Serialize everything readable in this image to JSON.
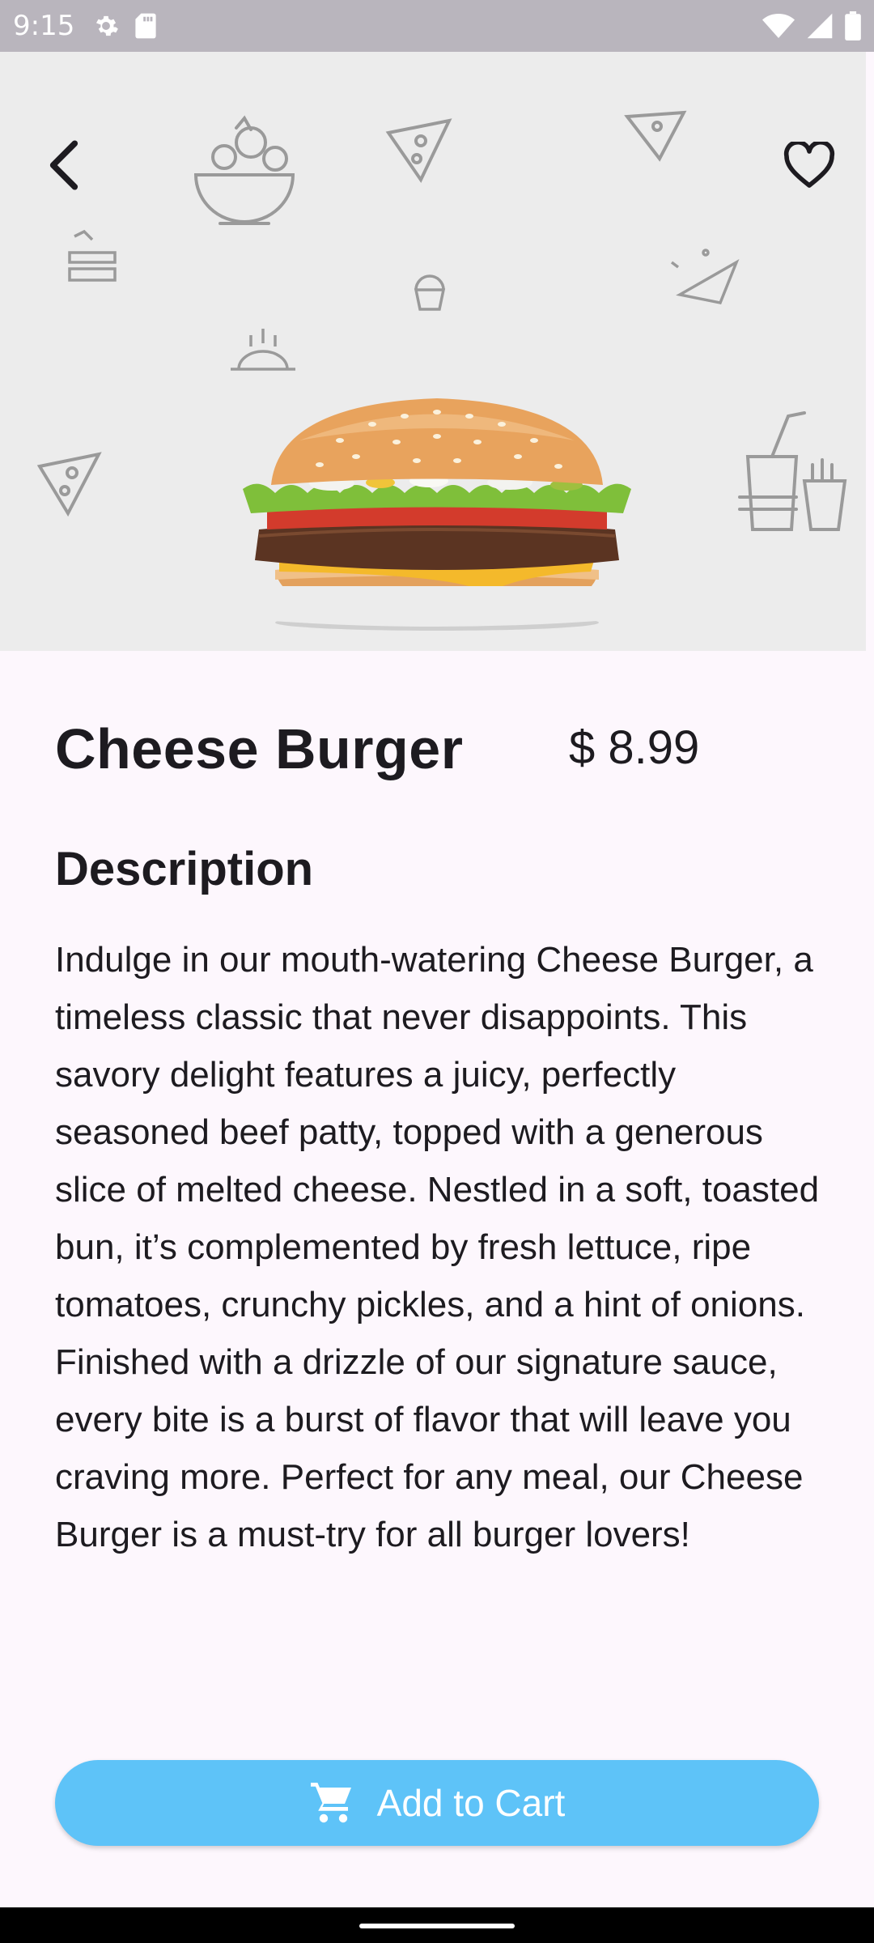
{
  "status_bar": {
    "time": "9:15",
    "icons_left": [
      "gear-icon",
      "sd-card-icon"
    ],
    "icons_right": [
      "wifi-icon",
      "signal-icon",
      "battery-icon"
    ]
  },
  "hero": {
    "back_icon": "chevron-left-icon",
    "favorite_icon": "heart-outline-icon",
    "image": "cheese-burger-photo",
    "background_color": "#ececec"
  },
  "product": {
    "name": "Cheese Burger",
    "price": "$ 8.99"
  },
  "description": {
    "heading": "Description",
    "text": "Indulge in our mouth-watering Cheese Burger, a timeless classic that never disappoints. This savory delight features a juicy, perfectly seasoned beef patty, topped with a generous slice of melted cheese. Nestled in a soft, toasted bun, it’s complemented by fresh lettuce, ripe tomatoes, crunchy pickles, and a hint of onions. Finished with a drizzle of our signature sauce, every bite is a burst of flavor that will leave you craving more. Perfect for any meal, our Cheese Burger is a must-try for all burger lovers!"
  },
  "cart": {
    "label": "Add to Cart",
    "icon": "cart-icon",
    "color": "#5ec3f8"
  }
}
